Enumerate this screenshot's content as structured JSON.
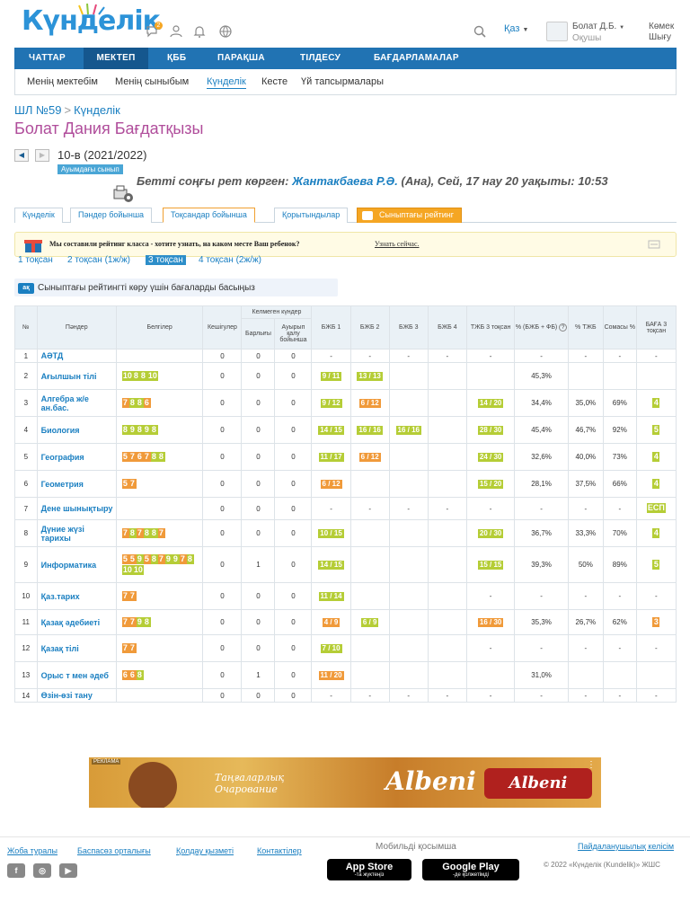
{
  "header": {
    "logo": "Күнделік",
    "lang": "Қаз",
    "user_name": "Болат Д.Б.",
    "user_role": "Оқушы",
    "help1": "Көмек",
    "help2": "Шығу",
    "notif_count": "2"
  },
  "nav": [
    "ЧАТТАР",
    "МЕКТЕП",
    "ҚББ",
    "ПАРАҚША",
    "ТІЛДЕСУ",
    "БАҒДАРЛАМАЛАР"
  ],
  "subnav": [
    "Менің мектебім",
    "Менің сыныбым",
    "Күнделік",
    "Кесте",
    "Үй тапсырмалары"
  ],
  "breadcrumb": {
    "school": "ШЛ №59",
    "page": "Күнделік"
  },
  "student_name": "Болат Дания Бағдатқызы",
  "class_info": "10-в (2021/2022)",
  "class_badge": "Ауымдағы сынып",
  "last_seen": {
    "prefix": "Бетті соңғы рет көрген: ",
    "who": "Жантакбаева Р.Ә.",
    "suffix": " (Ана), Сей, 17 нау 20 уақыты: 10:53"
  },
  "tabs": [
    "Күнделік",
    "Пәндер бойынша",
    "Тоқсандар бойынша",
    "Қорытындылар",
    "Сыныптағы рейтинг"
  ],
  "banner": {
    "text": "Мы составили рейтинг класса - хотите узнать, на каком месте Ваш ребенок?",
    "link": "Узнать сейчас."
  },
  "quarters": [
    "1 тоқсан",
    "2 тоқсан (1ж/ж)",
    "3 тоқсан",
    "4 тоқсан (2ж/ж)"
  ],
  "rating_hint": "Сыныптағы рейтингті көру үшін бағаларды басыңыз",
  "rating_icon": "ақ",
  "table": {
    "headers": {
      "num": "№",
      "subject": "Пәндер",
      "marks": "Белгілер",
      "late": "Кешігулер",
      "missed_group": "Келмеген күндер",
      "missed_total": "Барлығы",
      "missed_sick": "Ауырып қалу бойынша",
      "bjb1": "БЖБ 1",
      "bjb2": "БЖБ 2",
      "bjb3": "БЖБ 3",
      "bjb4": "БЖБ 4",
      "tjb": "ТЖБ 3 тоқсан",
      "pct_bjb": "% (БЖБ + ФБ)",
      "pct_tjb": "% ТЖБ",
      "sum": "Сомасы %",
      "grade": "БАҒА 3 тоқсан"
    },
    "rows": [
      {
        "n": "1",
        "s": "АӘТД",
        "marks": [],
        "late": "0",
        "miss": "0",
        "sick": "0",
        "b1": "-",
        "b2": "-",
        "b3": "-",
        "b4": "-",
        "tjb": "-",
        "pb": "-",
        "pt": "-",
        "sum": "-",
        "g": "-"
      },
      {
        "n": "2",
        "s": "Ағылшын тілі",
        "marks": [
          [
            "10",
            "g"
          ],
          [
            "8",
            "g"
          ],
          [
            "8",
            "g"
          ],
          [
            "10",
            "g"
          ]
        ],
        "late": "0",
        "miss": "0",
        "sick": "0",
        "b1": "9 / 11",
        "b2": "13 / 13",
        "b3": "",
        "b4": "",
        "tjb": "",
        "pb": "45,3%",
        "pt": "",
        "sum": "",
        "g": ""
      },
      {
        "n": "3",
        "s": "Алгебра ж/е ан.бас.",
        "marks": [
          [
            "7",
            "o"
          ],
          [
            "8",
            "g"
          ],
          [
            "8",
            "g"
          ],
          [
            "6",
            "o"
          ]
        ],
        "late": "0",
        "miss": "0",
        "sick": "0",
        "b1": "9 / 12",
        "b2": "6 / 12",
        "b3": "",
        "b4": "",
        "tjb": "14 / 20",
        "pb": "34,4%",
        "pt": "35,0%",
        "sum": "69%",
        "g": "4"
      },
      {
        "n": "4",
        "s": "Биология",
        "marks": [
          [
            "8",
            "g"
          ],
          [
            "9",
            "g"
          ],
          [
            "8",
            "g"
          ],
          [
            "9",
            "g"
          ],
          [
            "8",
            "g"
          ]
        ],
        "late": "0",
        "miss": "0",
        "sick": "0",
        "b1": "14 / 15",
        "b2": "16 / 16",
        "b3": "16 / 16",
        "b4": "",
        "tjb": "28 / 30",
        "pb": "45,4%",
        "pt": "46,7%",
        "sum": "92%",
        "g": "5"
      },
      {
        "n": "5",
        "s": "География",
        "marks": [
          [
            "5",
            "o"
          ],
          [
            "7",
            "o"
          ],
          [
            "6",
            "o"
          ],
          [
            "7",
            "o"
          ],
          [
            "8",
            "g"
          ],
          [
            "8",
            "g"
          ]
        ],
        "late": "0",
        "miss": "0",
        "sick": "0",
        "b1": "11 / 17",
        "b2": "6 / 12",
        "b3": "",
        "b4": "",
        "tjb": "24 / 30",
        "pb": "32,6%",
        "pt": "40,0%",
        "sum": "73%",
        "g": "4"
      },
      {
        "n": "6",
        "s": "Геометрия",
        "marks": [
          [
            "5",
            "o"
          ],
          [
            "7",
            "o"
          ]
        ],
        "late": "0",
        "miss": "0",
        "sick": "0",
        "b1": "6 / 12",
        "b2": "",
        "b3": "",
        "b4": "",
        "tjb": "15 / 20",
        "pb": "28,1%",
        "pt": "37,5%",
        "sum": "66%",
        "g": "4"
      },
      {
        "n": "7",
        "s": "Дене шынықтыру",
        "marks": [],
        "late": "0",
        "miss": "0",
        "sick": "0",
        "b1": "-",
        "b2": "-",
        "b3": "-",
        "b4": "-",
        "tjb": "-",
        "pb": "-",
        "pt": "-",
        "sum": "-",
        "g": "ЕСП"
      },
      {
        "n": "8",
        "s": "Дүние жүзі тарихы",
        "marks": [
          [
            "7",
            "o"
          ],
          [
            "8",
            "g"
          ],
          [
            "7",
            "o"
          ],
          [
            "8",
            "g"
          ],
          [
            "8",
            "g"
          ],
          [
            "7",
            "o"
          ]
        ],
        "late": "0",
        "miss": "0",
        "sick": "0",
        "b1": "10 / 15",
        "b2": "",
        "b3": "",
        "b4": "",
        "tjb": "20 / 30",
        "pb": "36,7%",
        "pt": "33,3%",
        "sum": "70%",
        "g": "4"
      },
      {
        "n": "9",
        "s": "Информатика",
        "marks": [
          [
            "5",
            "o"
          ],
          [
            "5",
            "o"
          ],
          [
            "9",
            "g"
          ],
          [
            "5",
            "o"
          ],
          [
            "8",
            "g"
          ],
          [
            "7",
            "o"
          ],
          [
            "9",
            "g"
          ],
          [
            "9",
            "g"
          ],
          [
            "7",
            "o"
          ],
          [
            "8",
            "g"
          ],
          [
            "10",
            "g"
          ],
          [
            "10",
            "g"
          ]
        ],
        "late": "0",
        "miss": "1",
        "sick": "0",
        "b1": "14 / 15",
        "b2": "",
        "b3": "",
        "b4": "",
        "tjb": "15 / 15",
        "pb": "39,3%",
        "pt": "50%",
        "sum": "89%",
        "g": "5"
      },
      {
        "n": "10",
        "s": "Қаз.тарих",
        "marks": [
          [
            "7",
            "o"
          ],
          [
            "7",
            "o"
          ]
        ],
        "late": "0",
        "miss": "0",
        "sick": "0",
        "b1": "11 / 14",
        "b2": "",
        "b3": "",
        "b4": "",
        "tjb": "-",
        "pb": "-",
        "pt": "-",
        "sum": "-",
        "g": "-"
      },
      {
        "n": "11",
        "s": "Қазақ әдебиеті",
        "marks": [
          [
            "7",
            "o"
          ],
          [
            "7",
            "o"
          ],
          [
            "9",
            "g"
          ],
          [
            "8",
            "g"
          ]
        ],
        "late": "0",
        "miss": "0",
        "sick": "0",
        "b1": "4 / 9",
        "b2": "6 / 9",
        "b3": "",
        "b4": "",
        "tjb": "16 / 30",
        "pb": "35,3%",
        "pt": "26,7%",
        "sum": "62%",
        "g": "3"
      },
      {
        "n": "12",
        "s": "Қазақ тілі",
        "marks": [
          [
            "7",
            "o"
          ],
          [
            "7",
            "o"
          ]
        ],
        "late": "0",
        "miss": "0",
        "sick": "0",
        "b1": "7 / 10",
        "b2": "",
        "b3": "",
        "b4": "",
        "tjb": "-",
        "pb": "-",
        "pt": "-",
        "sum": "-",
        "g": "-"
      },
      {
        "n": "13",
        "s": "Орыс т мен әдеб",
        "marks": [
          [
            "6",
            "o"
          ],
          [
            "6",
            "o"
          ],
          [
            "8",
            "g"
          ]
        ],
        "late": "0",
        "miss": "1",
        "sick": "0",
        "b1": "11 / 20",
        "b2": "",
        "b3": "",
        "b4": "",
        "tjb": "",
        "pb": "31,0%",
        "pt": "",
        "sum": "",
        "g": ""
      },
      {
        "n": "14",
        "s": "Өзін-өзі тану",
        "marks": [],
        "late": "0",
        "miss": "0",
        "sick": "0",
        "b1": "-",
        "b2": "-",
        "b3": "-",
        "b4": "-",
        "tjb": "-",
        "pb": "-",
        "pt": "-",
        "sum": "-",
        "g": "-"
      }
    ]
  },
  "ad": {
    "label": "РЕКЛАМА",
    "tagline1": "Таңғаларлық",
    "tagline2": "Очарование",
    "brand": "Albeni",
    "bar_label": "Albeni"
  },
  "footer": {
    "links": [
      "Жоба туралы",
      "Баспасөз орталығы",
      "Қолдау қызметі",
      "Контактілер"
    ],
    "mobile": "Мобильді қосымша",
    "appstore": "App Store",
    "appstore_sub": "-та жүктеңіз",
    "googleplay": "Google Play",
    "googleplay_sub": "-де қолжетімді",
    "terms": "Пайдаланушылық келісім",
    "copyright": "© 2022 «Күнделік (Kundelik)» ЖШС"
  },
  "colors": {
    "primary": "#2173b3",
    "accent_green": "#b5cd36",
    "accent_orange": "#f09a3a",
    "title": "#b04d9b"
  }
}
